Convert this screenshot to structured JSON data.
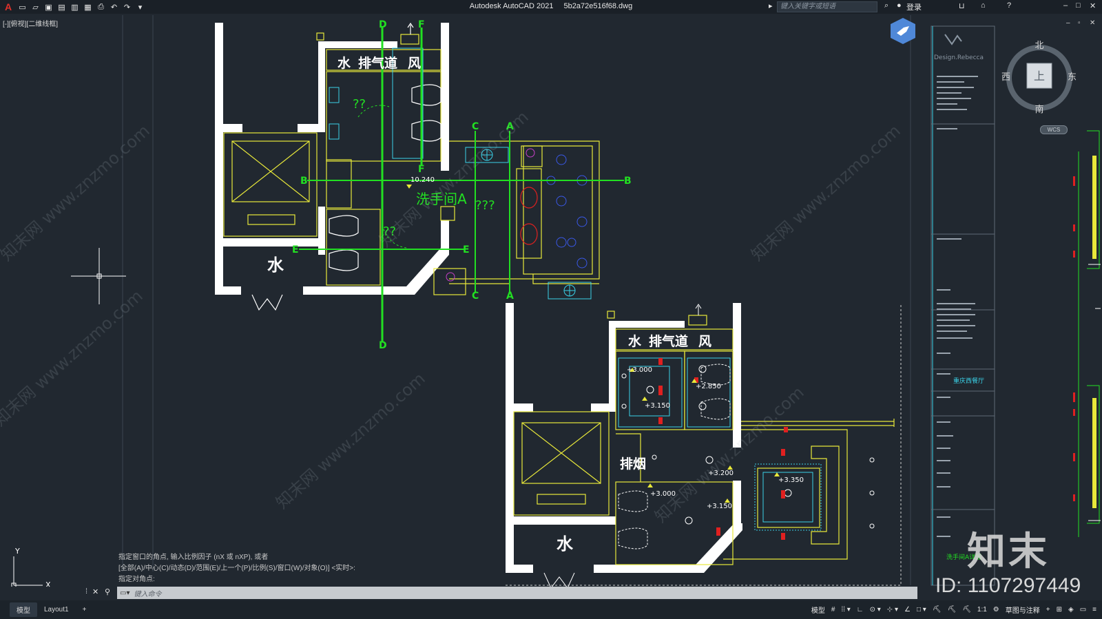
{
  "titlebar": {
    "app_name": "Autodesk AutoCAD 2021",
    "file_name": "5b2a72e516f68.dwg",
    "search_placeholder": "键入关键字或短语",
    "login": "登录"
  },
  "viewport": {
    "label": "[-][俯视][二维线框]"
  },
  "drawing": {
    "labels": {
      "water": "水",
      "exhaust": "排气道",
      "wind": "风",
      "smoke": "排烟",
      "washroom": "洗手间A",
      "q2": "??",
      "q3": "???",
      "elev1": "10.240",
      "e3000": "+3.000",
      "e3150": "+3.150",
      "e2850": "+2.850",
      "e3200": "+3.200",
      "e3350": "+3.350",
      "e3000b": "+3.000",
      "e3150b": "+3.150"
    },
    "axes": [
      "D",
      "F",
      "C",
      "A",
      "B",
      "E"
    ],
    "titleblock": {
      "brand": "Design.Rebecca",
      "project": "重庆西餐厅",
      "sheet": "洗手间A详图"
    }
  },
  "compass": {
    "north": "北",
    "south": "南",
    "east": "东",
    "west": "西",
    "top": "上",
    "wcs": "WCS"
  },
  "command": {
    "lines": [
      "指定窗口的角点, 输入比例因子 (nX 或 nXP), 或者",
      "[全部(A)/中心(C)/动态(D)/范围(E)/上一个(P)/比例(S)/窗口(W)/对象(O)] <实时>:",
      "指定对角点:"
    ],
    "input_placeholder": "键入命令"
  },
  "status": {
    "tabs": [
      "模型",
      "Layout1"
    ],
    "model_label": "模型",
    "scale": "1:1",
    "workspace": "草图与注释"
  },
  "watermark": {
    "logo_text": "知末",
    "id_text": "ID: 1107297449",
    "site": "知末网 www.znzmo.com"
  },
  "colors": {
    "bg": "#212830",
    "wall": "#ffffff",
    "yellow": "#e8e83a",
    "green": "#22e022",
    "cyan": "#3ad2e8",
    "red": "#e02020",
    "blue": "#3a58e8"
  }
}
